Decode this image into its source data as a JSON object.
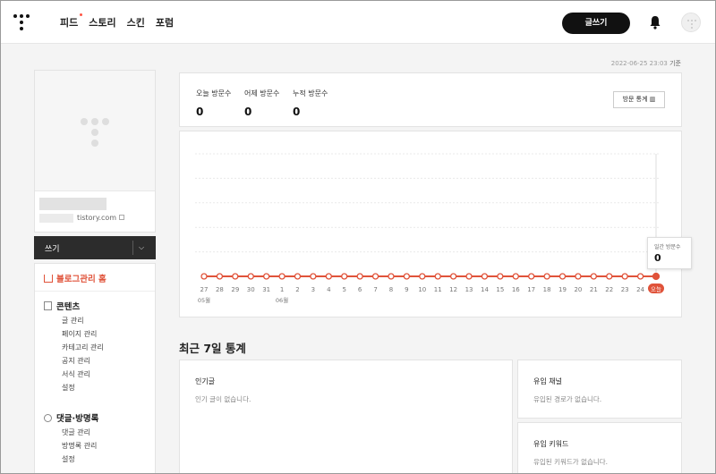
{
  "header": {
    "nav": [
      "피드",
      "스토리",
      "스킨",
      "포럼"
    ],
    "write_button": "글쓰기"
  },
  "timestamp": {
    "value": "2022-06-25 23:03",
    "suffix": "기준"
  },
  "sidebar": {
    "blog_url": "tistory.com",
    "write_bar": "쓰기",
    "home_label": "블로그관리 홈",
    "sections": [
      {
        "label": "콘텐츠",
        "icon": "document-icon",
        "items": [
          "글 관리",
          "페이지 관리",
          "카테고리 관리",
          "공지 관리",
          "서식 관리",
          "설정"
        ]
      },
      {
        "label": "댓글·방명록",
        "icon": "comment-icon",
        "items": [
          "댓글 관리",
          "방명록 관리",
          "설정"
        ]
      }
    ]
  },
  "stats": {
    "today": {
      "label": "오늘 방문수",
      "value": "0"
    },
    "yesterday": {
      "label": "어제 방문수",
      "value": "0"
    },
    "total": {
      "label": "누적 방문수",
      "value": "0"
    },
    "visit_stats_button": "방문 통계"
  },
  "chart_data": {
    "type": "line",
    "categories": [
      "27",
      "28",
      "29",
      "30",
      "31",
      "1",
      "2",
      "3",
      "4",
      "5",
      "6",
      "7",
      "8",
      "9",
      "10",
      "11",
      "12",
      "13",
      "14",
      "15",
      "16",
      "17",
      "18",
      "19",
      "20",
      "21",
      "22",
      "23",
      "24",
      "오늘"
    ],
    "month_labels": [
      {
        "at": "27",
        "text": "05월"
      },
      {
        "at": "1",
        "text": "06월"
      }
    ],
    "series": [
      {
        "values": [
          0,
          0,
          0,
          0,
          0,
          0,
          0,
          0,
          0,
          0,
          0,
          0,
          0,
          0,
          0,
          0,
          0,
          0,
          0,
          0,
          0,
          0,
          0,
          0,
          0,
          0,
          0,
          0,
          0,
          0
        ]
      }
    ],
    "color": "#e0533a",
    "grid": true,
    "tooltip": {
      "label": "일간 방문수",
      "value": "0"
    }
  },
  "recent": {
    "title": "최근 7일 통계",
    "popular": {
      "title": "인기글",
      "empty": "인기 글이 없습니다."
    },
    "channel": {
      "title": "유입 채널",
      "empty": "유입된 경로가 없습니다."
    },
    "keyword": {
      "title": "유입 키워드",
      "empty": "유입된 키워드가 없습니다."
    }
  }
}
